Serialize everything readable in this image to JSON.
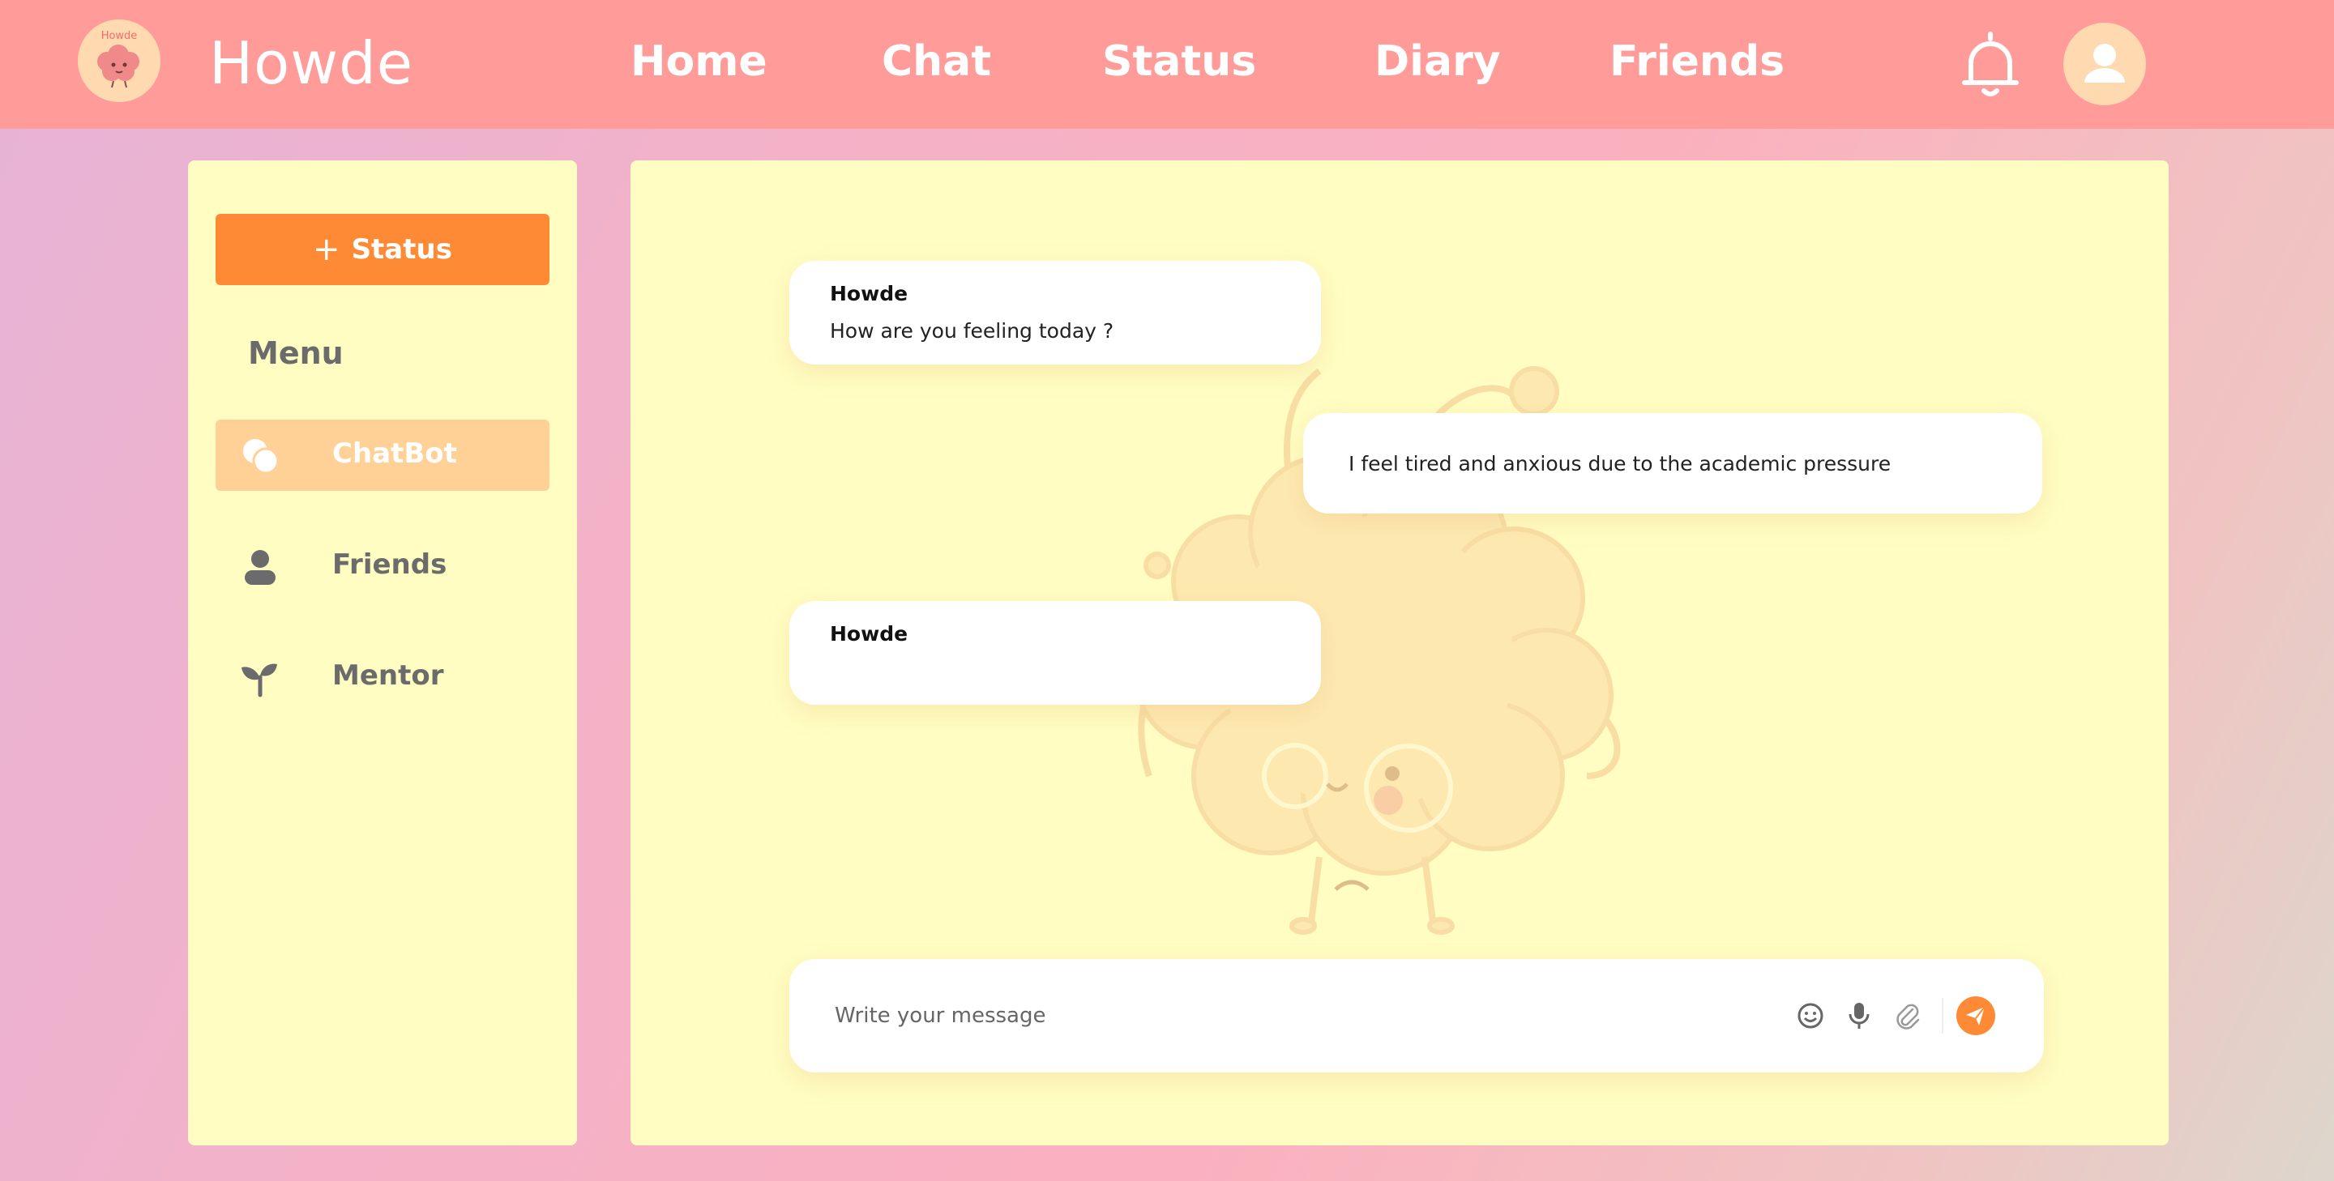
{
  "app": {
    "brand": "Howde",
    "logo_text": "Howde"
  },
  "nav": {
    "links": [
      {
        "label": "Home"
      },
      {
        "label": "Chat"
      },
      {
        "label": "Status"
      },
      {
        "label": "Diary"
      },
      {
        "label": "Friends"
      }
    ],
    "icons": {
      "notifications": "bell-icon",
      "profile": "user-icon"
    }
  },
  "sidebar": {
    "status_button": {
      "icon": "plus-icon",
      "label": "Status"
    },
    "menu_heading": "Menu",
    "items": [
      {
        "label": "ChatBot",
        "icon": "chat-bubbles-icon",
        "active": true
      },
      {
        "label": "Friends",
        "icon": "person-icon",
        "active": false
      },
      {
        "label": "Mentor",
        "icon": "sprout-icon",
        "active": false
      }
    ]
  },
  "chat": {
    "messages": [
      {
        "sender": "Howde",
        "text": "How are you feeling today ?"
      },
      {
        "sender": "user",
        "text": "I feel tired and anxious due to the academic pressure"
      },
      {
        "sender": "Howde",
        "text": ""
      }
    ],
    "composer": {
      "placeholder": "Write your message",
      "icons": [
        "emoji-icon",
        "microphone-icon",
        "attachment-icon",
        "send-icon"
      ]
    }
  },
  "colors": {
    "topbar": "#ff9c9a",
    "panel": "#fffdc2",
    "accent": "#ff8a35",
    "active_item": "#ffd196",
    "muted_text": "#6b6b6b"
  }
}
